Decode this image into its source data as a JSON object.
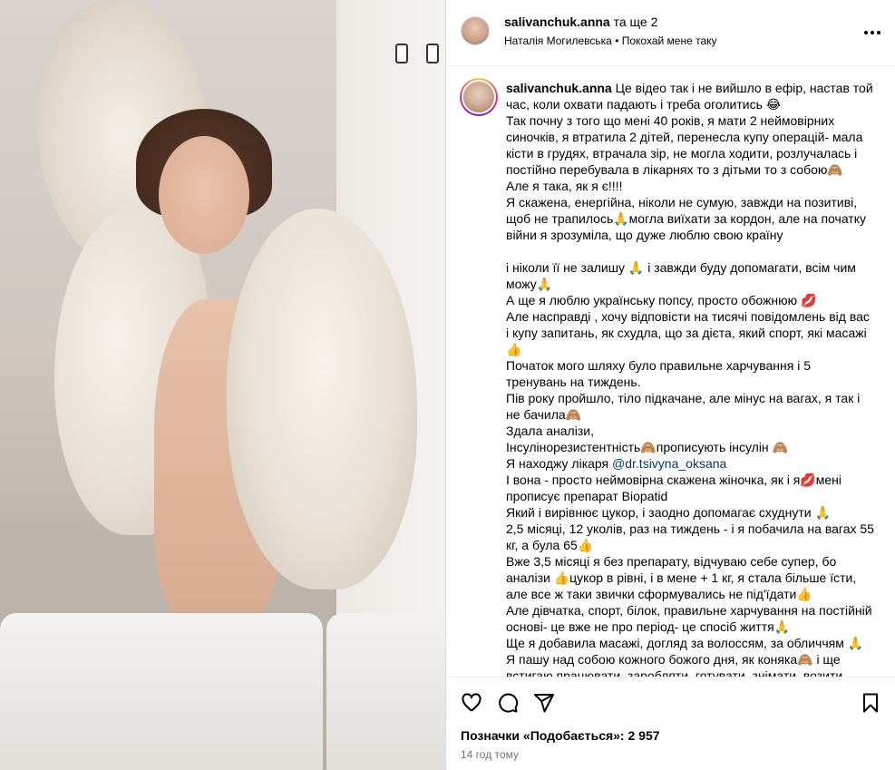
{
  "post": {
    "header": {
      "username": "salivanchuk.anna",
      "coauthors": "та ще 2",
      "audio_artist": "Наталія Могилевська",
      "separator": "•",
      "audio_title": "Покохай мене таку",
      "more_icon": "more-horizontal-icon"
    },
    "caption": {
      "username": "salivanchuk.anna",
      "lines": [
        "Це відео так і не вийшло в ефір, настав той",
        "час, коли охвати падають і треба оголитись 😂",
        "Так почну з того що мені 40 років, я мати 2 неймовірних",
        "синочків, я втратила 2 дітей, перенесла купу операцій- мала",
        "кісти в грудях, втрачала зір, не могла ходити, розлучалась і",
        "постійно перебувала в лікарнях то з дітьми то з собою🙈",
        "Але я така, як я є!!!!",
        "Я скажена, енергійна, ніколи не сумую, завжди на позитиві,",
        "щоб не трапилось🙏могла виїхати за кордон, але на початку",
        "війни я зрозуміла, що дуже люблю свою країну",
        "",
        "і ніколи її не залишу 🙏 і завжди буду допомагати, всім чим",
        "можу🙏",
        "А ще я люблю українську попсу, просто обожнюю 💋",
        "Але насправді , хочу відповісти на тисячі повідомлень від вас",
        "і купу запитань, як схудла, що за дієта, який спорт, які масажі",
        "👍",
        "Початок мого шляху було правильне харчування і 5",
        "тренувань на тиждень.",
        "Пів року пройшло, тіло підкачане, але мінус на вагах, я так і",
        "не бачила🙈",
        "Здала аналізи,",
        "Інсулінорезистентність🙈прописують інсулін 🙈",
        "Я находжу лікаря ",
        "І вона - просто неймовірна скажена жіночка, як і я💋мені",
        "прописує препарат Biopatid",
        "Який і вирівнює цукор, і заодно допомагає схуднути 🙏",
        "2,5 місяці, 12 уколів, раз на тиждень - і я побачила на вагах 55",
        "кг, а була 65👍",
        "Вже 3,5 місяці я без препарату, відчуваю себе супер, бо",
        "аналізи 👍цукор в рівні, і в мене + 1 кг, я стала більше їсти,",
        "але все ж таки звички сформувались не під'їдати👍",
        "Але дівчатка, спорт, білок, правильне харчування на постійній",
        "основі- це вже не про період- це спосіб життя🙏",
        "Ще я добавила масажі, догляд за волоссям, за обличчям 🙏",
        "Я пашу над собою кожного божого дня, як коняка🙈 і ще",
        "встигаю працювати, заробляти, готувати, знімати, возити"
      ],
      "mention": "@dr.tsivyna_oksana"
    },
    "actions": {
      "like_icon": "heart-icon",
      "comment_icon": "comment-icon",
      "share_icon": "share-icon",
      "save_icon": "bookmark-icon",
      "likes_label": "Позначки «Подобається»: 2 957",
      "timestamp": "14 год тому"
    }
  }
}
